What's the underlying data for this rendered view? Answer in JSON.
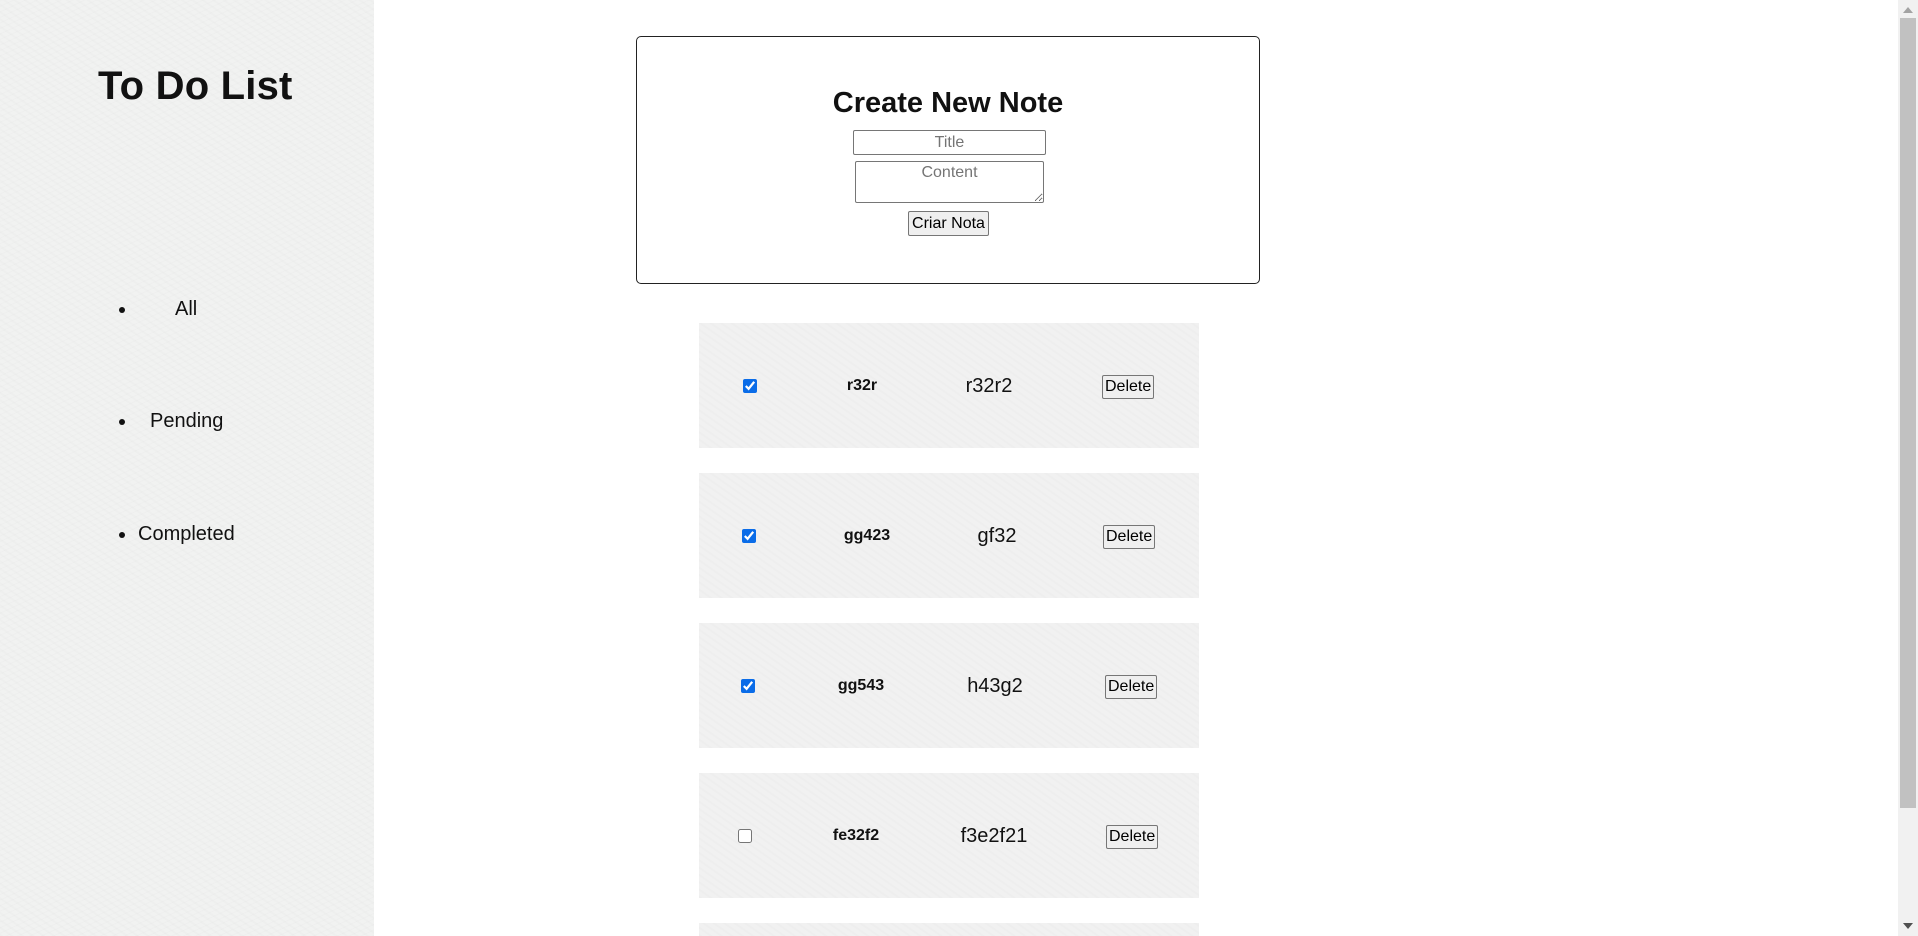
{
  "sidebar": {
    "title": "To Do List",
    "filters": [
      {
        "label": "All"
      },
      {
        "label": "Pending"
      },
      {
        "label": "Completed"
      }
    ]
  },
  "form": {
    "heading": "Create New Note",
    "title_placeholder": "Title",
    "content_placeholder": "Content",
    "submit_label": "Criar Nota"
  },
  "notes": [
    {
      "title": "r32r",
      "content": "r32r2",
      "completed": true,
      "delete_label": "Delete"
    },
    {
      "title": "gg423",
      "content": "gf32",
      "completed": true,
      "delete_label": "Delete"
    },
    {
      "title": "gg543",
      "content": "h43g2",
      "completed": true,
      "delete_label": "Delete"
    },
    {
      "title": "fe32f2",
      "content": "f3e2f21",
      "completed": false,
      "delete_label": "Delete"
    }
  ]
}
